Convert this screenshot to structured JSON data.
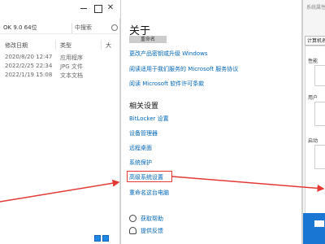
{
  "explorer": {
    "path_text": "OK 9.0 64位",
    "search_placeholder": "中搜索",
    "columns": [
      "修改日期",
      "类型",
      "大"
    ],
    "rows": [
      {
        "date": "2020/8/20 12:47",
        "type": "应用程序"
      },
      {
        "date": "2022/2/25 22:34",
        "type": "JPG 文件"
      },
      {
        "date": "2022/1/19 15:08",
        "type": "文本文档"
      }
    ]
  },
  "settings": {
    "about_title": "关于",
    "rename_button": "重命名",
    "links": [
      "更改产品密钥或升级 Windows",
      "阅读适用于我们服务的 Microsoft 服务协议",
      "阅读 Microsoft 软件许可条款"
    ],
    "related_title": "相关设置",
    "related_links": [
      "BitLocker 设置",
      "设备管理器",
      "远程桌面",
      "系统保护",
      "高级系统设置",
      "重命名这台电脑"
    ],
    "help": {
      "get_help": "获取帮助",
      "feedback": "提供反馈"
    }
  },
  "sysprop": {
    "title": "系统属性",
    "tab": "计算机名",
    "labels": [
      "性能",
      "用户",
      "启动"
    ]
  },
  "colors": {
    "link": "#0066b8",
    "annotation": "#e53935",
    "accent": "#1976d2"
  }
}
